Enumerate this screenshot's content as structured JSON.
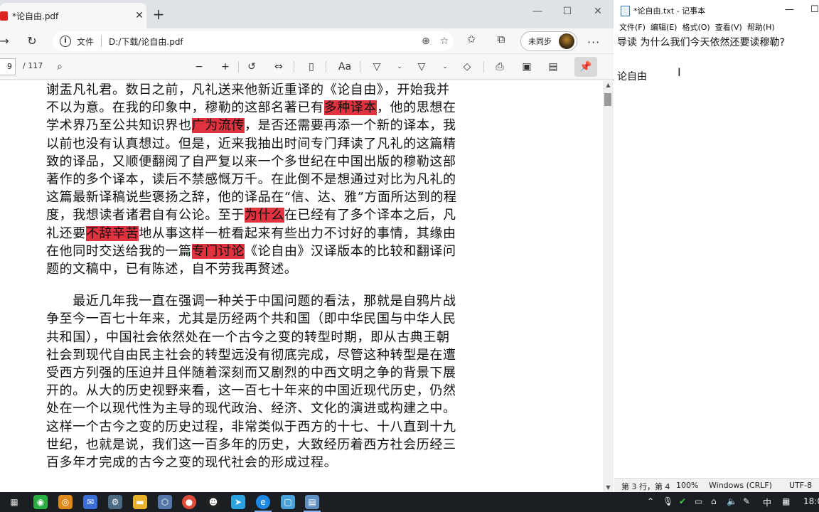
{
  "edge": {
    "tab_title": "*论自由.pdf",
    "tab_close": "✕",
    "new_tab": "+",
    "address_label": "文件",
    "url": "D:/下载/论自由.pdf",
    "sync_label": "未同步",
    "page_number": "9",
    "page_total": "/ 117"
  },
  "document": {
    "paragraph1": [
      [
        {
          "t": "谢盂凡礼君。数日之前，凡礼送来他新近重译的《论自由》，开始我并"
        }
      ],
      [
        {
          "t": "不以为意。在我的印象中，穆勒的这部名著已有"
        },
        {
          "t": "多种译本",
          "h": true
        },
        {
          "t": "，他的思想在"
        }
      ],
      [
        {
          "t": "学术界乃至公共知识界也"
        },
        {
          "t": "广为流传",
          "h": true
        },
        {
          "t": "，是否还需要再添一个新的译本，我"
        }
      ],
      [
        {
          "t": "以前也没有认真想过。但是，近来我抽出时间专门拜读了凡礼的这篇精"
        }
      ],
      [
        {
          "t": "致的译品，又顺便翻阅了自严复以来一个多世纪在中国出版的穆勒这部"
        }
      ],
      [
        {
          "t": "著作的多个译本，读后不禁感慨万千。在此倒不是想通过对比为凡礼的"
        }
      ],
      [
        {
          "t": "这篇最新译稿说些褒扬之辞，他的译品在“信、达、雅”方面所达到的程"
        }
      ],
      [
        {
          "t": "度，我想读者诸君自有公论。至于"
        },
        {
          "t": "为什么",
          "h": true
        },
        {
          "t": "在已经有了多个译本之后，凡"
        }
      ],
      [
        {
          "t": "礼还要"
        },
        {
          "t": "不辞辛苦",
          "h": true
        },
        {
          "t": "地从事这样一桩看起来有些出力不讨好的事情，其缘由"
        }
      ],
      [
        {
          "t": "在他同时交送给我的一篇"
        },
        {
          "t": "专门讨论",
          "h": true
        },
        {
          "t": "《论自由》汉译版本的比较和翻译问"
        }
      ],
      [
        {
          "t": "题的文稿中，已有陈述，自不劳我再赘述。"
        }
      ]
    ],
    "paragraph2": [
      "　　最近几年我一直在强调一种关于中国问题的看法，那就是自鸦片战",
      "争至今一百七十年来，尤其是历经两个共和国（即中华民国与中华人民",
      "共和国），中国社会依然处在一个古今之变的转型时期，即从古典王朝",
      "社会到现代自由民主社会的转型远没有彻底完成，尽管这种转型是在遭",
      "受西方列强的压迫并且伴随着深刻而又剧烈的中西文明之争的背景下展",
      "开的。从大的历史视野来看，这一百七十年来的中国近现代历史，仍然",
      "处在一个以现代性为主导的现代政治、经济、文化的演进或构建之中。",
      "这样一个古今之变的历史过程，非常类似于西方的十七、十八直到十九",
      "世纪，也就是说，我们这一百多年的历史，大致经历着西方社会历经三",
      "百多年才完成的古今之变的现代社会的形成过程。"
    ]
  },
  "notepad": {
    "title": "*论自由.txt - 记事本",
    "menu": [
      "文件(F)",
      "编辑(E)",
      "格式(O)",
      "查看(V)",
      "帮助(H)"
    ],
    "lines": [
      "导读 为什么我们今天依然还要读穆勒?",
      "",
      "论自由"
    ],
    "status": {
      "position": "第 3 行，第 4",
      "zoom": "100%",
      "eol": "Windows (CRLF)",
      "encoding": "UTF-8"
    }
  },
  "taskbar": {
    "ime": "中",
    "clock": "18:0"
  }
}
